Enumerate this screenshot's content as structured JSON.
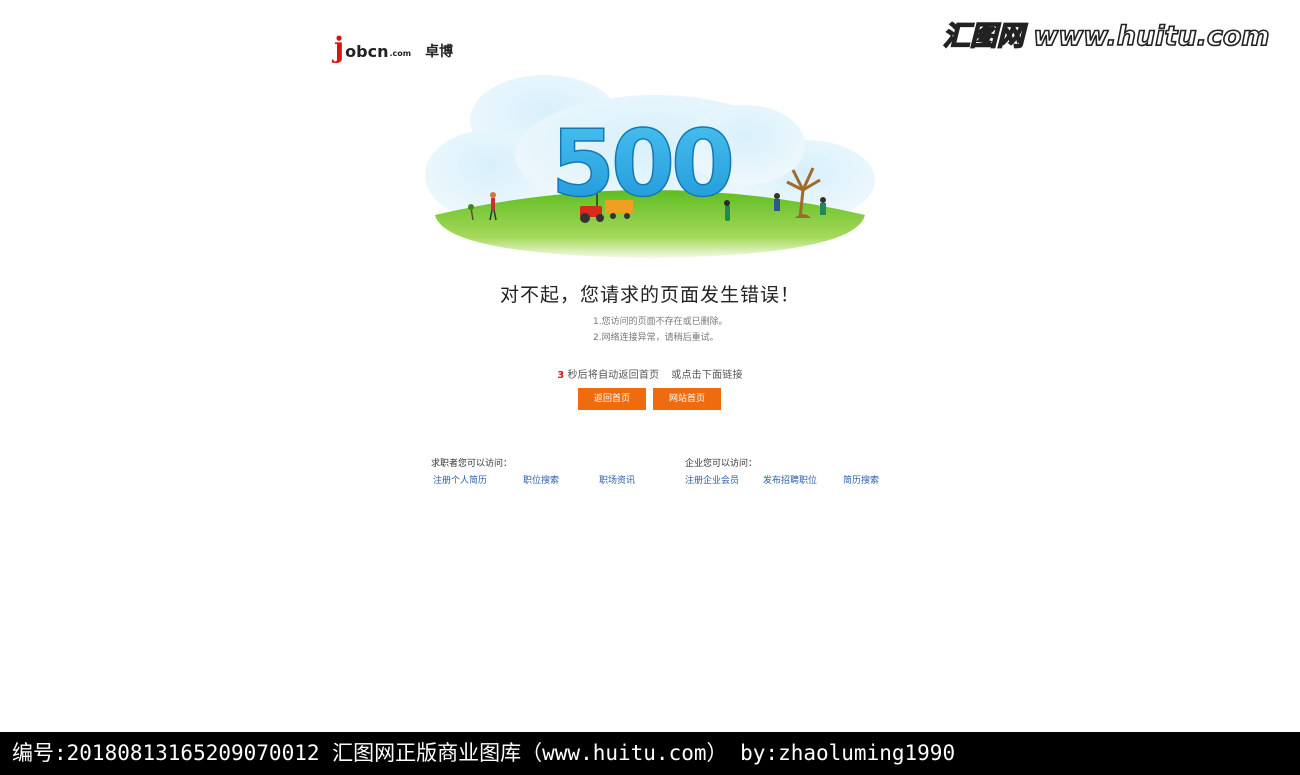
{
  "watermark": "汇图网 www.huitu.com",
  "logo": {
    "letter": "j",
    "text": "obcn",
    "suffix": ".com",
    "cn": "卓博"
  },
  "hero": {
    "code": "500"
  },
  "headline": "对不起，您请求的页面发生错误！",
  "reasons": [
    "1.您访问的页面不存在或已删除。",
    "2.网络连接异常，请稍后重试。"
  ],
  "hint": {
    "marker": "3",
    "text": "秒后将自动返回首页",
    "alt": "或点击下面链接"
  },
  "buttons": {
    "back": "返回首页",
    "home": "网站首页"
  },
  "groups": [
    {
      "title": "求职者您可以访问：",
      "links": [
        "注册个人简历",
        "职位搜索",
        "职场资讯"
      ]
    },
    {
      "title": "企业您可以访问：",
      "links": [
        "注册企业会员",
        "发布招聘职位",
        "简历搜索"
      ]
    }
  ],
  "caption": "编号:20180813165209070012   汇图网正版商业图库（www.huitu.com） by:zhaoluming1990",
  "colors": {
    "accent": "#f06b0e",
    "link": "#2a5ea8",
    "brand_red": "#d51414",
    "digits": "#1ea8e6",
    "grass": "#6dc22a"
  }
}
